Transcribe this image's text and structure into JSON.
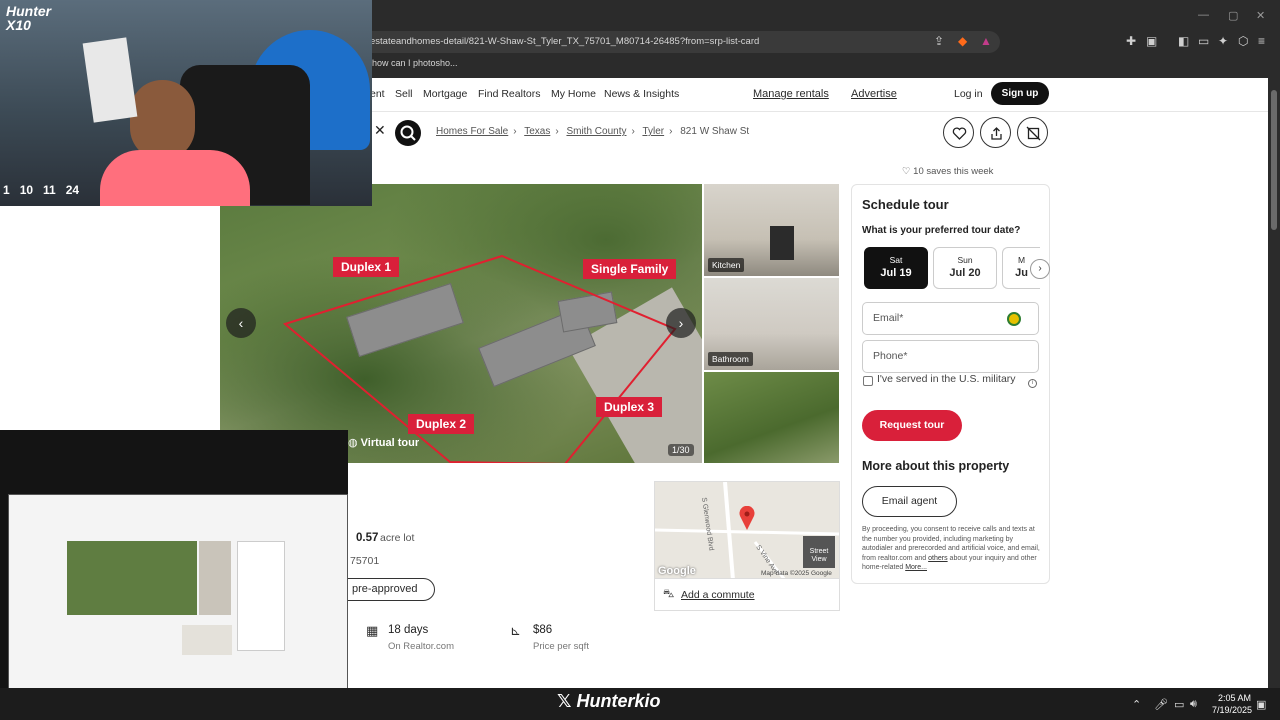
{
  "browser": {
    "url": "estateandhomes-detail/821-W-Shaw-St_Tyler_TX_75701_M80714-26485?from=srp-list-card",
    "bookmark": "how can I photosho..."
  },
  "nav": {
    "partial_item": "ent",
    "items": [
      "Sell",
      "Mortgage",
      "Find Realtors",
      "My Home",
      "News & Insights"
    ],
    "manage_rentals": "Manage rentals",
    "advertise": "Advertise",
    "login": "Log in",
    "signup": "Sign up"
  },
  "breadcrumb": [
    "Homes For Sale",
    "Texas",
    "Smith County",
    "Tyler"
  ],
  "breadcrumb_current": "821 W Shaw St",
  "saves": "10 saves this week",
  "photos": {
    "tags": [
      "Duplex 1",
      "Single Family",
      "Duplex 2",
      "Duplex 3"
    ],
    "virtual_tour": "Virtual tour",
    "count": "1/30",
    "thumb_labels": [
      "Kitchen",
      "Bathroom"
    ]
  },
  "facts": {
    "lot": "0.57",
    "lot_unit": "acre lot",
    "zip_partial": "75701",
    "preapproved": "pre-approved",
    "days": "18 days",
    "days_sub": "On Realtor.com",
    "price_sqft": "$86",
    "price_sqft_sub": "Price per sqft"
  },
  "map": {
    "attribution": "Map data ©2025 Google",
    "google": "Google",
    "street_view": "Street View",
    "road1": "S Glenwood Blvd",
    "road2": "S Vine Ave",
    "commute": "Add a commute"
  },
  "schedule": {
    "title": "Schedule tour",
    "question": "What is your preferred tour date?",
    "dates": [
      {
        "dow": "Sat",
        "date": "Jul 19"
      },
      {
        "dow": "Sun",
        "date": "Jul 20"
      },
      {
        "dow": "M",
        "date": "Ju"
      }
    ],
    "email_placeholder": "Email*",
    "phone_placeholder": "Phone*",
    "military": "I've served in the U.S. military",
    "request_tour": "Request tour",
    "more_about": "More about this property",
    "email_agent": "Email agent",
    "disclaimer_a": "By proceeding, you consent to receive calls and texts at the number you provided, including marketing by autodialer and prerecorded and artificial voice, and email, from realtor.com and ",
    "disclaimer_others": "others",
    "disclaimer_b": " about your inquiry and other home-related ",
    "disclaimer_more": "More..."
  },
  "stream": {
    "logo": "Hunter\nX10",
    "hud": [
      "1",
      "10",
      "11",
      "24"
    ],
    "brand": "Hunterkio"
  },
  "taskbar": {
    "time": "2:05 AM",
    "date": "7/19/2025"
  },
  "colors": {
    "accent_red": "#d9203a",
    "dark": "#111111"
  }
}
